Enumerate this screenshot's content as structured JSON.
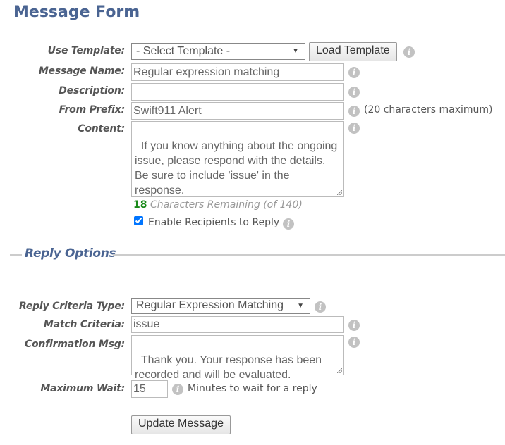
{
  "message_form": {
    "title": "Message Form",
    "use_template": {
      "label": "Use Template:",
      "selected": "- Select Template -",
      "load_button": "Load Template"
    },
    "message_name": {
      "label": "Message Name:",
      "value": "Regular expression matching"
    },
    "description": {
      "label": "Description:",
      "value": ""
    },
    "from_prefix": {
      "label": "From Prefix:",
      "value": "Swift911 Alert",
      "note": "(20 characters maximum)"
    },
    "content": {
      "label": "Content:",
      "value": "If you know anything about the ongoing issue, please respond with the details. Be sure to include 'issue' in the response.",
      "remaining_count": "18",
      "remaining_text": "Characters Remaining (of 140)",
      "count_color": "#1a8a1a"
    },
    "enable_reply": {
      "label": "Enable Recipients to Reply",
      "checked": true
    }
  },
  "reply_options": {
    "title": "Reply Options",
    "criteria_type": {
      "label": "Reply Criteria Type:",
      "selected": "Regular Expression Matching"
    },
    "match_criteria": {
      "label": "Match Criteria:",
      "value": "issue"
    },
    "confirmation": {
      "label": "Confirmation Msg:",
      "value": "Thank you. Your response has been recorded and will be evaluated."
    },
    "max_wait": {
      "label": "Maximum Wait:",
      "value": "15",
      "note": "Minutes to wait for a reply"
    }
  },
  "actions": {
    "update_button": "Update Message"
  },
  "icons": {
    "info": "i",
    "dropdown": "▼"
  },
  "colors": {
    "heading": "#4a6492",
    "info_icon": "#c2c2c2"
  }
}
